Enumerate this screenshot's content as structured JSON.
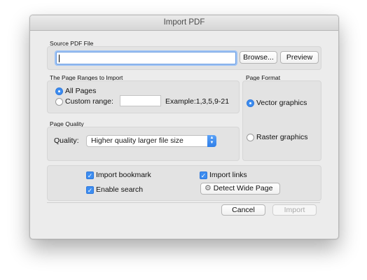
{
  "window": {
    "title": "Import PDF"
  },
  "source": {
    "label": "Source PDF File",
    "path_value": "",
    "browse_label": "Browse...",
    "preview_label": "Preview"
  },
  "ranges": {
    "label": "The Page Ranges to Import",
    "all_pages_label": "All Pages",
    "all_pages_selected": true,
    "custom_range_label": "Custom range:",
    "custom_range_value": "",
    "example_text": "Example:1,3,5,9-21"
  },
  "quality": {
    "label": "Page Quality",
    "field_label": "Quality:",
    "selected": "Higher quality larger file size"
  },
  "format": {
    "label": "Page Format",
    "vector_label": "Vector graphics",
    "vector_selected": true,
    "raster_label": "Raster graphics"
  },
  "options": {
    "import_bookmark_label": "Import bookmark",
    "enable_search_label": "Enable search",
    "import_links_label": "Import links",
    "detect_wide_page_label": "Detect Wide Page",
    "import_bookmark_checked": true,
    "enable_search_checked": true,
    "import_links_checked": true
  },
  "footer": {
    "cancel_label": "Cancel",
    "import_label": "Import"
  },
  "colors": {
    "accent": "#3d8df0",
    "window_bg": "#ececec",
    "group_bg": "#e3e3e3"
  },
  "icons": {
    "checkmark": "checkmark-icon",
    "detect_wide_page": "gear-icon",
    "select_arrows": "up-down-chevron-icon"
  }
}
